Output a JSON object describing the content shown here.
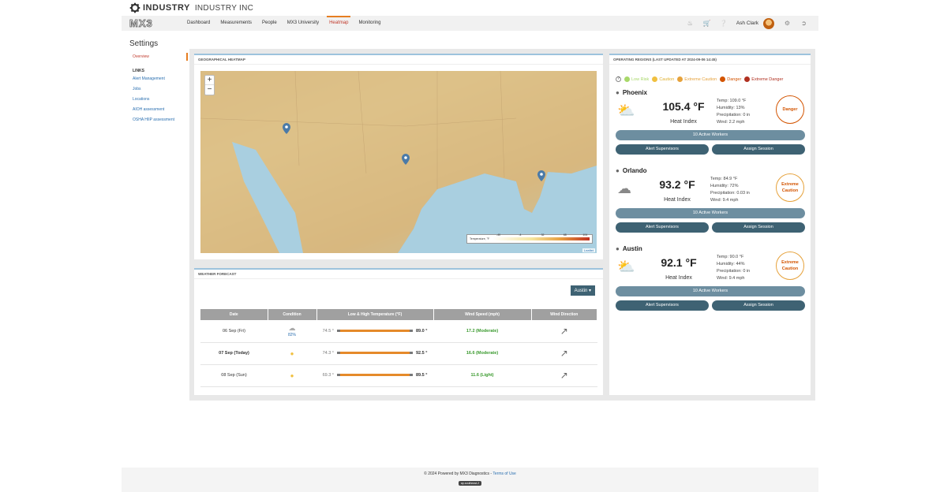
{
  "header": {
    "logo_text": "INDUSTRY",
    "brand": "INDUSTRY INC",
    "mx_logo": "MX3"
  },
  "nav": {
    "items": [
      "Dashboard",
      "Measurements",
      "People",
      "MX3 University",
      "Heatmap",
      "Monitoring"
    ],
    "active": "Heatmap",
    "user": "Ash Clark"
  },
  "sidebar": {
    "title": "Settings",
    "overview": "Overview",
    "links_header": "LINKS",
    "links": [
      "Alert Management",
      "Jobs",
      "Locations",
      "AIOH assessment",
      "OSHA HIIP assessment"
    ]
  },
  "map_panel": {
    "title": "GEOGRAPHICAL HEATMAP",
    "zoom_in": "+",
    "zoom_out": "−",
    "legend_label": "Temperature, °F",
    "legend_ticks": [
      "-40",
      "-4",
      "32",
      "68",
      "104"
    ],
    "attribution": "Leaflet"
  },
  "forecast": {
    "title": "WEATHER FORECAST",
    "location": "Austin",
    "columns": [
      "Date",
      "Condition",
      "Low & High Temperature (°F)",
      "Wind Speed (mph)",
      "Wind Direction"
    ],
    "rows": [
      {
        "date": "06 Sep (Fri)",
        "condition": "82%",
        "low": "74.5 °",
        "high": "89.0 °",
        "wind": "17.2 (Moderate)"
      },
      {
        "date": "07 Sep (Today)",
        "condition": "",
        "low": "74.3 °",
        "high": "92.5 °",
        "wind": "16.6 (Moderate)"
      },
      {
        "date": "08 Sep (Sun)",
        "condition": "",
        "low": "69.3 °",
        "high": "89.5 °",
        "wind": "11.6 (Light)"
      }
    ]
  },
  "regions": {
    "title": "OPERATING REGIONS (LAST UPDATED AT 2024-09-06 14:45)",
    "legend": [
      {
        "label": "Low Risk",
        "color": "#a8d86a"
      },
      {
        "label": "Caution",
        "color": "#f0c040"
      },
      {
        "label": "Extreme Caution",
        "color": "#e6a23c"
      },
      {
        "label": "Danger",
        "color": "#d35400"
      },
      {
        "label": "Extreme Danger",
        "color": "#b03020"
      }
    ],
    "items": [
      {
        "name": "Phoenix",
        "heat_index": "105.4 °F",
        "heat_label": "Heat Index",
        "temp": "Temp: 109.0 °F",
        "humidity": "Humidity: 13%",
        "precip": "Precipitation: 0 in",
        "wind": "Wind: 2.2 mph",
        "risk": "Danger",
        "workers": "10 Active Workers",
        "alert": "Alert Supervisors",
        "assign": "Assign Session"
      },
      {
        "name": "Orlando",
        "heat_index": "93.2 °F",
        "heat_label": "Heat Index",
        "temp": "Temp: 84.9 °F",
        "humidity": "Humidity: 72%",
        "precip": "Precipitation: 0.03 in",
        "wind": "Wind: 9.4 mph",
        "risk": "Extreme Caution",
        "workers": "10 Active Workers",
        "alert": "Alert Supervisors",
        "assign": "Assign Session"
      },
      {
        "name": "Austin",
        "heat_index": "92.1 °F",
        "heat_label": "Heat Index",
        "temp": "Temp: 90.0 °F",
        "humidity": "Humidity: 44%",
        "precip": "Precipitation: 0 in",
        "wind": "Wind: 9.4 mph",
        "risk": "Extreme Caution",
        "workers": "10 Active Workers",
        "alert": "Alert Supervisors",
        "assign": "Assign Session"
      }
    ]
  },
  "footer": {
    "copyright": "© 2024 Powered by MX3 Diagnostics - ",
    "terms": "Terms of Use",
    "badge": "ap-southeast-2"
  }
}
